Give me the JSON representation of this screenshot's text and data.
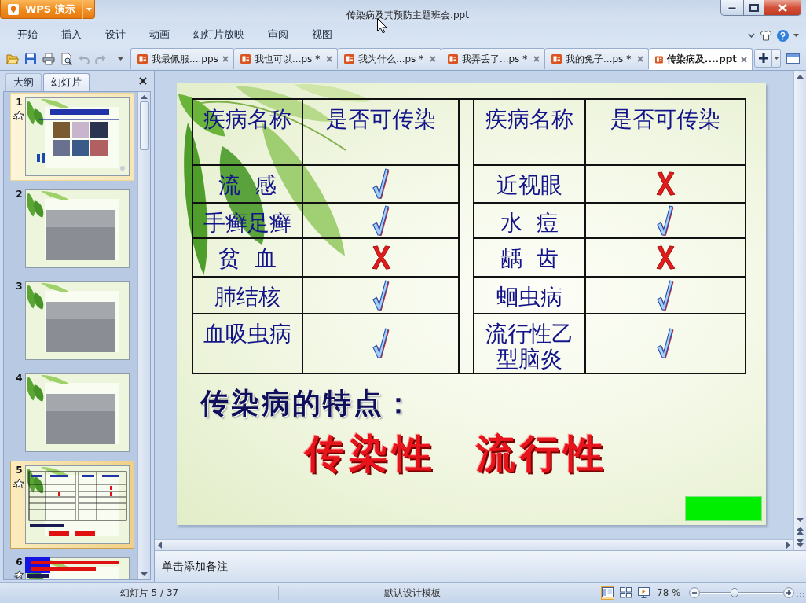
{
  "window": {
    "app_button": "WPS 演示",
    "title": "传染病及其预防主题班会.ppt"
  },
  "menu": [
    "开始",
    "插入",
    "设计",
    "动画",
    "幻灯片放映",
    "审阅",
    "视图"
  ],
  "doc_tabs": [
    {
      "label": "我最佩服....pps",
      "selected": false
    },
    {
      "label": "我也可以...ps *",
      "selected": false
    },
    {
      "label": "我为什么...ps *",
      "selected": false
    },
    {
      "label": "我弄丢了...ps *",
      "selected": false
    },
    {
      "label": "我的兔子...ps *",
      "selected": false
    },
    {
      "label": "传染病及....ppt",
      "selected": true
    }
  ],
  "panel": {
    "tabs": [
      {
        "label": "大纲",
        "selected": false
      },
      {
        "label": "幻灯片",
        "selected": true
      }
    ],
    "slides": [
      {
        "number": "1",
        "kind": "title",
        "animated": true,
        "highlighted": true,
        "selected": false
      },
      {
        "number": "2",
        "kind": "photo",
        "animated": false,
        "highlighted": false,
        "selected": false
      },
      {
        "number": "3",
        "kind": "photo",
        "animated": false,
        "highlighted": false,
        "selected": false
      },
      {
        "number": "4",
        "kind": "photo",
        "animated": false,
        "highlighted": false,
        "selected": false
      },
      {
        "number": "5",
        "kind": "table",
        "animated": true,
        "highlighted": false,
        "selected": true
      },
      {
        "number": "6",
        "kind": "banner",
        "animated": true,
        "highlighted": false,
        "selected": false
      }
    ]
  },
  "slide": {
    "table": {
      "columns": [
        "疾病名称",
        "是否可传染",
        "疾病名称",
        "是否可传染"
      ],
      "rows": [
        {
          "left": {
            "name": "流 感",
            "contagious": true
          },
          "right": {
            "name": "近视眼",
            "contagious": false
          }
        },
        {
          "left": {
            "name": "手癣足癣",
            "contagious": true
          },
          "right": {
            "name": "水 痘",
            "contagious": true
          }
        },
        {
          "left": {
            "name": "贫 血",
            "contagious": false
          },
          "right": {
            "name": "龋 齿",
            "contagious": false
          }
        },
        {
          "left": {
            "name": "肺结核",
            "contagious": true
          },
          "right": {
            "name": "蛔虫病",
            "contagious": true
          }
        },
        {
          "left": {
            "name": "血吸虫病",
            "contagious": true
          },
          "right": {
            "name": "流行性乙型脑炎",
            "contagious": true
          }
        }
      ]
    },
    "heading": "传染病的特点：",
    "features": [
      "传染性",
      "流行性"
    ]
  },
  "notes": {
    "placeholder": "单击添加备注"
  },
  "status_bar": {
    "slide_position": "幻灯片 5 / 37",
    "template": "默认设计模板",
    "views": [
      {
        "kind": "normal",
        "selected": true
      },
      {
        "kind": "sorter",
        "selected": false
      },
      {
        "kind": "slideshow",
        "selected": false
      }
    ],
    "zoom": "78 %",
    "zoom_slider": {
      "level": 0.42
    }
  }
}
